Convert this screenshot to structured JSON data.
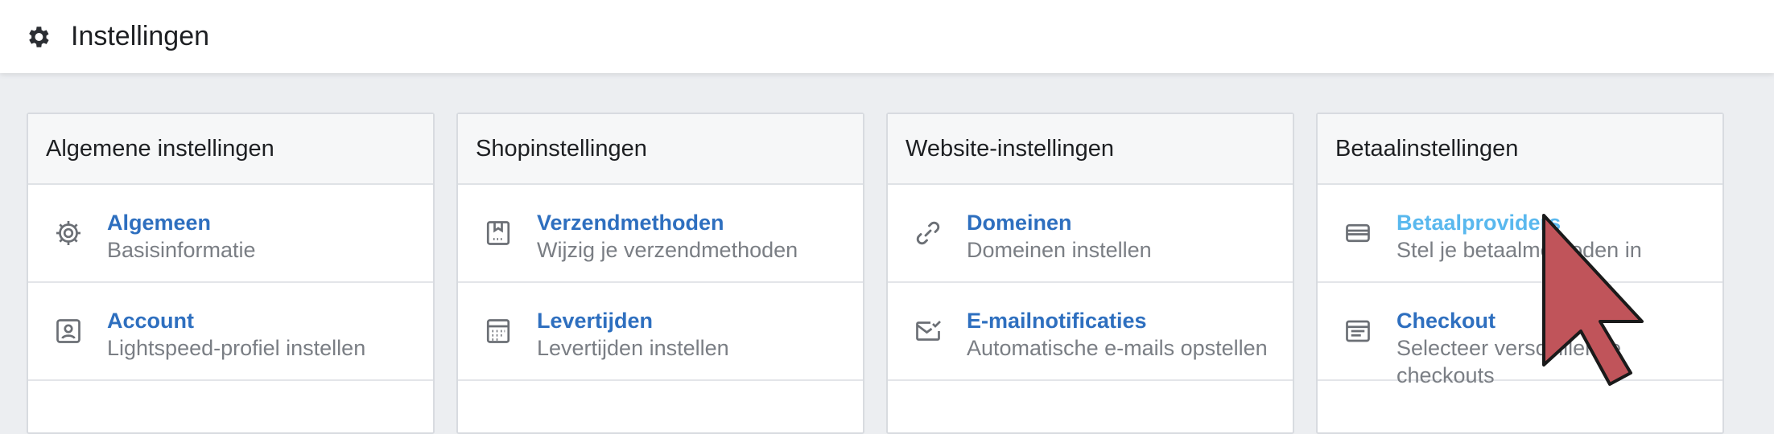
{
  "header": {
    "title": "Instellingen",
    "icon": "gear-icon"
  },
  "colors": {
    "link": "#2e6fbf",
    "link_hover": "#59b8ee",
    "subtext": "#7a7e84",
    "cursor": "#c0545a"
  },
  "panels": [
    {
      "title": "Algemene instellingen",
      "items": [
        {
          "label": "Algemeen",
          "sub": "Basisinformatie",
          "icon": "gear-icon"
        },
        {
          "label": "Account",
          "sub": "Lightspeed-profiel instellen",
          "icon": "profile-icon"
        }
      ]
    },
    {
      "title": "Shopinstellingen",
      "items": [
        {
          "label": "Verzendmethoden",
          "sub": "Wijzig je verzendmethoden",
          "icon": "box-icon"
        },
        {
          "label": "Levertijden",
          "sub": "Levertijden instellen",
          "icon": "calendar-icon"
        }
      ]
    },
    {
      "title": "Website-instellingen",
      "items": [
        {
          "label": "Domeinen",
          "sub": "Domeinen instellen",
          "icon": "link-icon"
        },
        {
          "label": "E-mailnotificaties",
          "sub": "Automatische e-mails opstellen",
          "icon": "mail-icon"
        }
      ]
    },
    {
      "title": "Betaalinstellingen",
      "items": [
        {
          "label": "Betaalproviders",
          "sub": "Stel je betaalmethoden in",
          "icon": "credit-card-icon"
        },
        {
          "label": "Checkout",
          "sub": "Selecteer verschillende checkouts",
          "icon": "checkout-icon"
        }
      ]
    }
  ]
}
